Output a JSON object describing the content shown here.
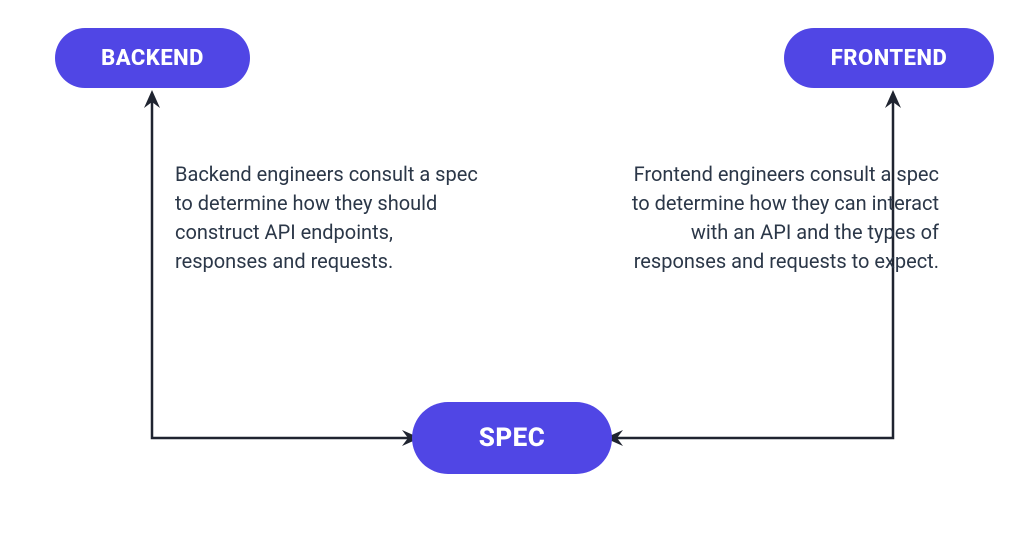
{
  "colors": {
    "brand": "#5046e5",
    "text_dark": "#2b3748",
    "arrow": "#1f2430"
  },
  "nodes": {
    "backend": {
      "label": "BACKEND"
    },
    "frontend": {
      "label": "FRONTEND"
    },
    "spec": {
      "label": "SPEC"
    }
  },
  "descriptions": {
    "backend": "Backend engineers consult a spec to determine how they should construct API endpoints, responses and requests.",
    "frontend": "Frontend engineers consult a spec to determine how they can interact with an API and the types of responses and requests to expect."
  }
}
